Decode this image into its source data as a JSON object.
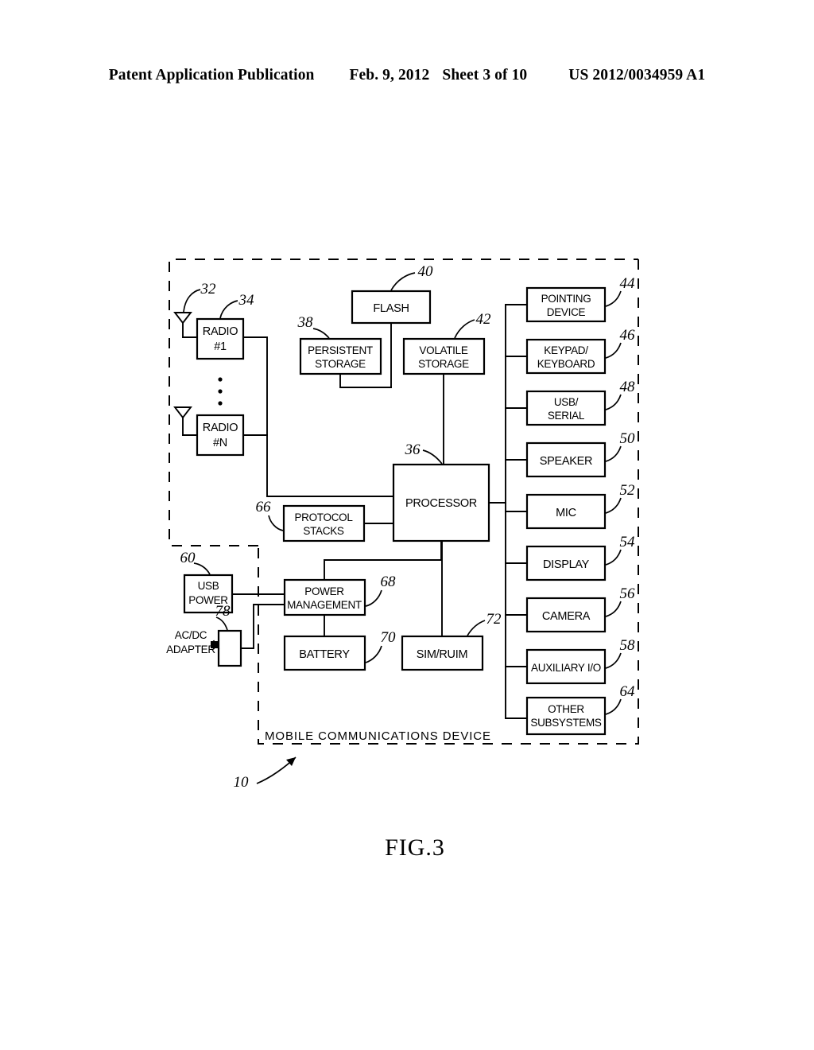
{
  "header": {
    "publication": "Patent Application Publication",
    "date": "Feb. 9, 2012",
    "sheet": "Sheet 3 of 10",
    "number": "US 2012/0034959 A1"
  },
  "figure": {
    "caption": "FIG.3",
    "enclosure_label": "MOBILE  COMMUNICATIONS  DEVICE",
    "enclosure_ref": "10",
    "ellipsis_symbol": "•"
  },
  "blocks": {
    "radio1": {
      "line1": "RADIO",
      "line2": "#1",
      "ref": "34"
    },
    "radion": {
      "line1": "RADIO",
      "line2": "#N",
      "ref": ""
    },
    "antenna1": {
      "ref": "32"
    },
    "antenna_n": {
      "ref": ""
    },
    "flash": {
      "line1": "FLASH",
      "ref": "40"
    },
    "persistent_storage": {
      "line1": "PERSISTENT",
      "line2": "STORAGE",
      "ref": "38"
    },
    "volatile_storage": {
      "line1": "VOLATILE",
      "line2": "STORAGE",
      "ref": "42"
    },
    "processor": {
      "line1": "PROCESSOR",
      "ref": "36"
    },
    "protocol_stacks": {
      "line1": "PROTOCOL",
      "line2": "STACKS",
      "ref": "66"
    },
    "usb_power": {
      "line1": "USB",
      "line2": "POWER",
      "ref": "60"
    },
    "acdc_adapter": {
      "line1": "AC/DC",
      "line2": "ADAPTER",
      "ref": "78"
    },
    "power_management": {
      "line1": "POWER",
      "line2": "MANAGEMENT",
      "ref": "68"
    },
    "battery": {
      "line1": "BATTERY",
      "ref": "70"
    },
    "sim_ruim": {
      "line1": "SIM/RUIM",
      "ref": "72"
    }
  },
  "peripherals": [
    {
      "line1": "POINTING",
      "line2": "DEVICE",
      "ref": "44"
    },
    {
      "line1": "KEYPAD/",
      "line2": "KEYBOARD",
      "ref": "46"
    },
    {
      "line1": "USB/",
      "line2": "SERIAL",
      "ref": "48"
    },
    {
      "line1": "SPEAKER",
      "line2": "",
      "ref": "50"
    },
    {
      "line1": "MIC",
      "line2": "",
      "ref": "52"
    },
    {
      "line1": "DISPLAY",
      "line2": "",
      "ref": "54"
    },
    {
      "line1": "CAMERA",
      "line2": "",
      "ref": "56"
    },
    {
      "line1": "AUXILIARY  I/O",
      "line2": "",
      "ref": "58"
    },
    {
      "line1": "OTHER",
      "line2": "SUBSYSTEMS",
      "ref": "64"
    }
  ],
  "colors": {
    "ink": "#000000",
    "paper": "#ffffff"
  }
}
